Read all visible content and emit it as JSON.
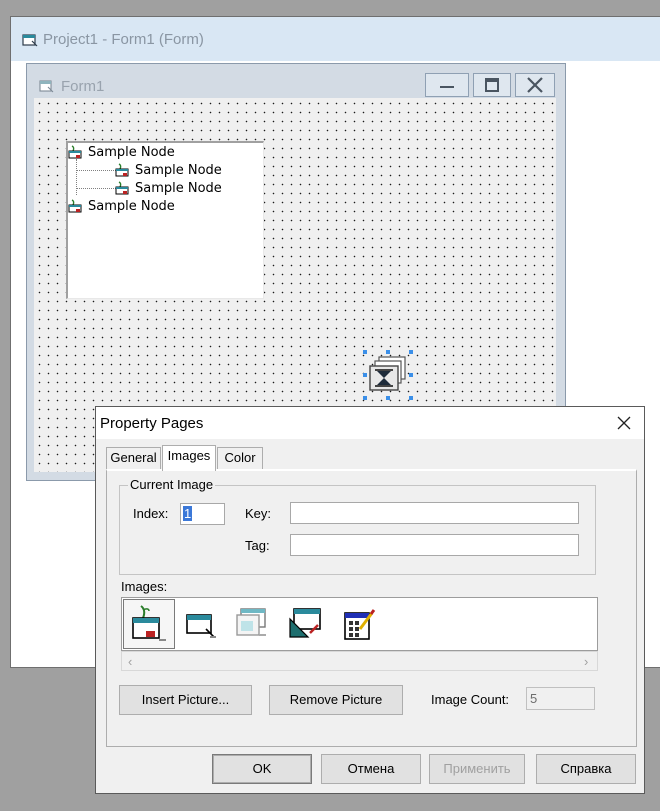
{
  "project_window": {
    "title": "Project1 - Form1 (Form)"
  },
  "form1": {
    "title": "Form1",
    "treeview": {
      "nodes": [
        {
          "label": "Sample Node",
          "level": 0
        },
        {
          "label": "Sample Node",
          "level": 1
        },
        {
          "label": "Sample Node",
          "level": 1
        },
        {
          "label": "Sample Node",
          "level": 0
        }
      ]
    }
  },
  "dialog": {
    "title": "Property Pages",
    "tabs": [
      {
        "label": "General",
        "active": false
      },
      {
        "label": "Images",
        "active": true
      },
      {
        "label": "Color",
        "active": false
      }
    ],
    "current_image": {
      "legend": "Current Image",
      "index_label": "Index:",
      "index_value": "1",
      "key_label": "Key:",
      "key_value": "",
      "tag_label": "Tag:",
      "tag_value": ""
    },
    "images_label": "Images:",
    "images": [
      {
        "icon": "book-plant-icon",
        "selected": true
      },
      {
        "icon": "folder-window-icon",
        "selected": false
      },
      {
        "icon": "folder-pages-icon",
        "selected": false
      },
      {
        "icon": "folder-ruler-icon",
        "selected": false
      },
      {
        "icon": "calculator-pencil-icon",
        "selected": false
      }
    ],
    "buttons": {
      "insert_picture": "Insert Picture...",
      "remove_picture": "Remove Picture",
      "ok": "OK",
      "cancel": "Отмена",
      "apply": "Применить",
      "help": "Справка"
    },
    "image_count_label": "Image Count:",
    "image_count_value": "5"
  },
  "colors": {
    "title_bar": "#d9e7f4",
    "selection": "#3b78d8",
    "handle": "#3b8fe8"
  }
}
